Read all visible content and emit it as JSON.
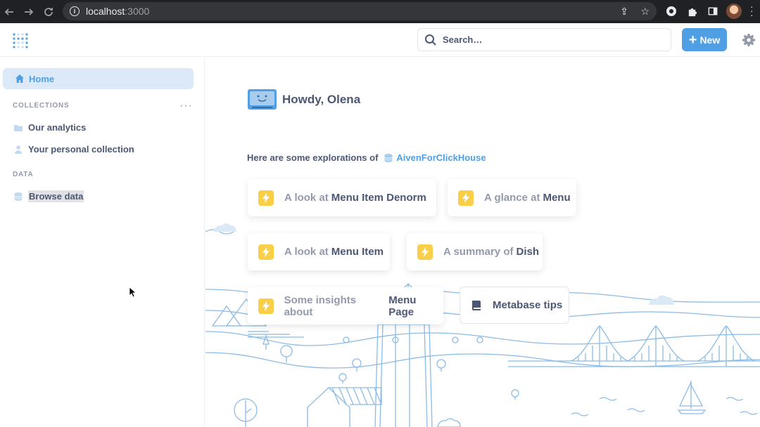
{
  "browser": {
    "url_host": "localhost",
    "url_port": ":3000"
  },
  "header": {
    "search_placeholder": "Search…",
    "new_button": "New"
  },
  "sidebar": {
    "home_label": "Home",
    "collections_heading": "COLLECTIONS",
    "collections_more": "···",
    "collections": [
      {
        "label": "Our analytics",
        "icon": "folder-icon"
      },
      {
        "label": "Your personal collection",
        "icon": "person-icon"
      }
    ],
    "data_heading": "DATA",
    "browse_data": "Browse data"
  },
  "main": {
    "greeting": "Howdy, Olena",
    "explore_prefix": "Here are some explorations of",
    "database": "AivenForClickHouse",
    "cards": [
      {
        "prefix": "A look at",
        "object": "Menu Item Denorm"
      },
      {
        "prefix": "A glance at",
        "object": "Menu"
      },
      {
        "prefix": "A look at",
        "object": "Menu Item"
      },
      {
        "prefix": "A summary of",
        "object": "Dish"
      },
      {
        "prefix": "Some insights about",
        "object": "Menu Page"
      }
    ],
    "tips_label": "Metabase tips"
  },
  "colors": {
    "brand": "#509ee3",
    "bolt": "#f9cf48",
    "text": "#4c5773",
    "muted": "#949aab"
  }
}
